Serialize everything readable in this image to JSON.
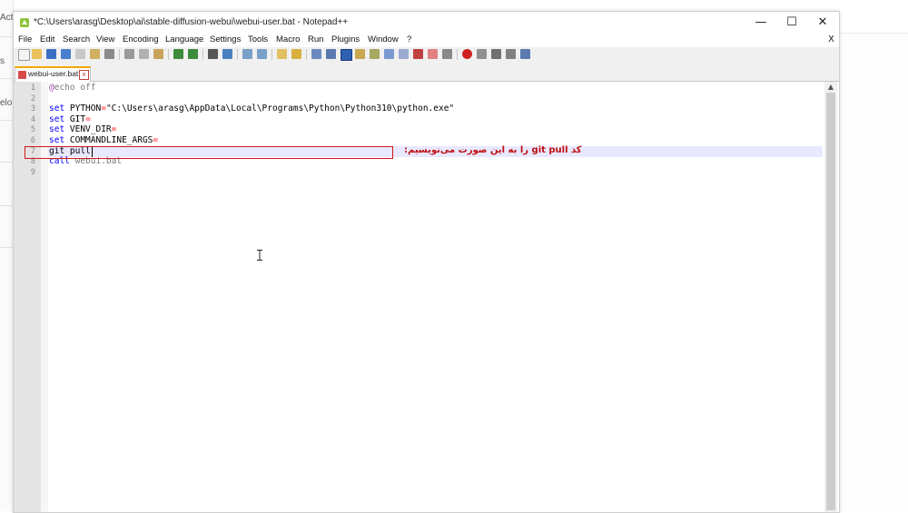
{
  "background": {
    "left_labels": [
      "Acti",
      "s",
      "elo"
    ]
  },
  "window": {
    "title": "*C:\\Users\\arasg\\Desktop\\ai\\stable-diffusion-webui\\webui-user.bat - Notepad++",
    "controls": {
      "minimize": "—",
      "maximize": "☐",
      "close": "✕"
    }
  },
  "menu": {
    "items": [
      "File",
      "Edit",
      "Search",
      "View",
      "Encoding",
      "Language",
      "Settings",
      "Tools",
      "Macro",
      "Run",
      "Plugins",
      "Window",
      "?"
    ],
    "close_label": "X"
  },
  "tab": {
    "label": "webui-user.bat",
    "close": "x"
  },
  "editor": {
    "line_numbers": [
      "1",
      "2",
      "3",
      "4",
      "5",
      "6",
      "7",
      "8",
      "9"
    ],
    "lines": {
      "l1_at": "@",
      "l1_rest": "echo off",
      "l3_kw": "set",
      "l3_var": " PYTHON",
      "l3_op": "=",
      "l3_val": "\"C:\\Users\\arasg\\AppData\\Local\\Programs\\Python\\Python310\\python.exe\"",
      "l4_kw": "set",
      "l4_var": " GIT",
      "l4_op": "=",
      "l5_kw": "set",
      "l5_var": " VENV_DIR",
      "l5_op": "=",
      "l6_kw": "set",
      "l6_var": " COMMANDLINE_ARGS",
      "l6_op": "=",
      "l7_text": "git pull",
      "l8_kw": "call",
      "l8_val": " webui.bat"
    },
    "annotation": "کد git pull را به این صورت می‌نویسیم:"
  },
  "colors": {
    "highlight_box": "#d01818",
    "keyword": "#0000ff",
    "current_line": "#e8e8ff"
  }
}
